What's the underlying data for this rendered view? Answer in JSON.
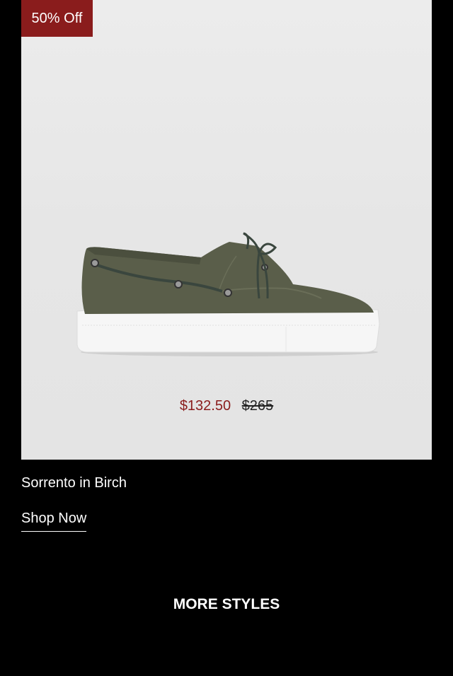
{
  "product": {
    "badge": "50% Off",
    "name": "Sorrento in Birch",
    "sale_price": "$132.50",
    "original_price": "$265",
    "image_icon": "shoe-image",
    "shoe_color": "#5a5e4a",
    "sole_color": "#f5f5f5"
  },
  "cta": {
    "shop_now_label": "Shop Now"
  },
  "section": {
    "more_styles_title": "MORE STYLES"
  },
  "colors": {
    "badge_bg": "#8a1c1c",
    "sale_price": "#8a1c1c",
    "page_bg": "#000000"
  }
}
